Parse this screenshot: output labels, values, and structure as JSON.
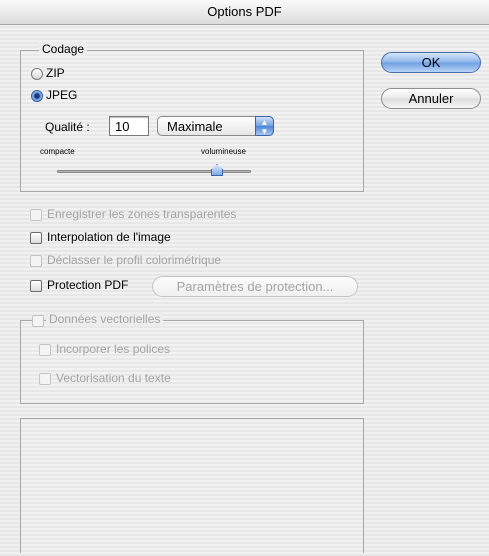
{
  "window": {
    "title": "Options PDF"
  },
  "encoding": {
    "legend": "Codage",
    "zip_label": "ZIP",
    "jpeg_label": "JPEG",
    "selected": "JPEG",
    "quality_label": "Qualité :",
    "quality_value": "10",
    "quality_preset": "Maximale",
    "slider_min_label": "compacte",
    "slider_max_label": "volumineuse",
    "slider_level_fraction": 0.83
  },
  "options": {
    "transparent_zones": "Enregistrer les zones transparentes",
    "image_interpolation": "Interpolation de l'image",
    "downgrade_profile": "Déclasser le profil colorimétrique",
    "protection": "Protection PDF",
    "protection_settings_button": "Paramètres de protection..."
  },
  "vector": {
    "legend": "Données vectorielles",
    "embed_fonts": "Incorporer les polices",
    "vectorize_text": "Vectorisation du texte"
  },
  "buttons": {
    "ok": "OK",
    "cancel": "Annuler"
  },
  "colors": {
    "accent": "#6e9fe2",
    "disabled_text": "#a3a3a3",
    "background": "#ececec"
  }
}
